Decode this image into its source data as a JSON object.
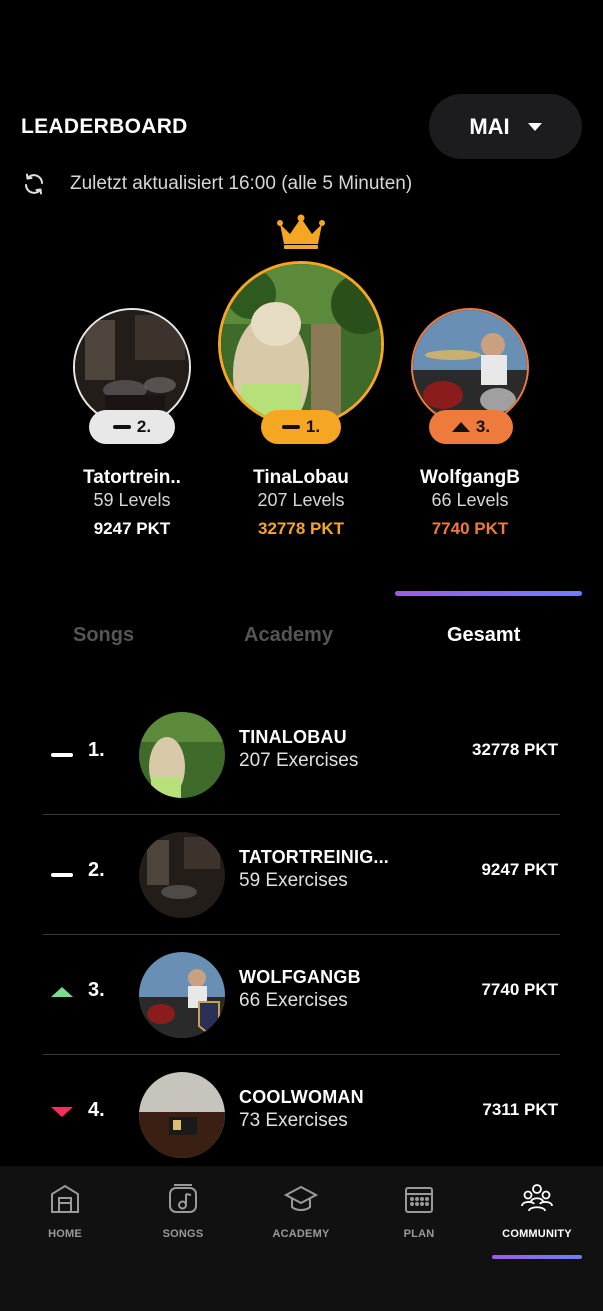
{
  "header": {
    "title": "LEADERBOARD",
    "month": "MAI"
  },
  "status": {
    "updated_text": "Zuletzt aktualisiert 16:00 (alle 5 Minuten)"
  },
  "podium": [
    {
      "name": "Tatortrein..",
      "levels": "59 Levels",
      "points": "9247 PKT",
      "rank": "2.",
      "trend": "same",
      "color": "#e8e8e8"
    },
    {
      "name": "TinaLobau",
      "levels": "207 Levels",
      "points": "32778 PKT",
      "rank": "1.",
      "trend": "same",
      "color": "#f5a623"
    },
    {
      "name": "WolfgangB",
      "levels": "66 Levels",
      "points": "7740 PKT",
      "rank": "3.",
      "trend": "up",
      "color": "#ee7a3c"
    }
  ],
  "tabs": [
    {
      "label": "Songs",
      "active": false
    },
    {
      "label": "Academy",
      "active": false
    },
    {
      "label": "Gesamt",
      "active": true
    }
  ],
  "list": [
    {
      "rank": "1.",
      "trend": "same",
      "username": "TINALOBAU",
      "exercises": "207 Exercises",
      "points": "32778 PKT"
    },
    {
      "rank": "2.",
      "trend": "same",
      "username": "TATORTREINIG...",
      "exercises": "59 Exercises",
      "points": "9247 PKT"
    },
    {
      "rank": "3.",
      "trend": "up",
      "username": "WOLFGANGB",
      "exercises": "66 Exercises",
      "points": "7740 PKT"
    },
    {
      "rank": "4.",
      "trend": "down",
      "username": "COOLWOMAN",
      "exercises": "73 Exercises",
      "points": "7311 PKT"
    }
  ],
  "nav": [
    {
      "label": "HOME",
      "icon": "home-icon",
      "active": false
    },
    {
      "label": "SONGS",
      "icon": "music-note-icon",
      "active": false
    },
    {
      "label": "ACADEMY",
      "icon": "graduation-cap-icon",
      "active": false
    },
    {
      "label": "PLAN",
      "icon": "calendar-icon",
      "active": false
    },
    {
      "label": "COMMUNITY",
      "icon": "community-icon",
      "active": true
    }
  ]
}
